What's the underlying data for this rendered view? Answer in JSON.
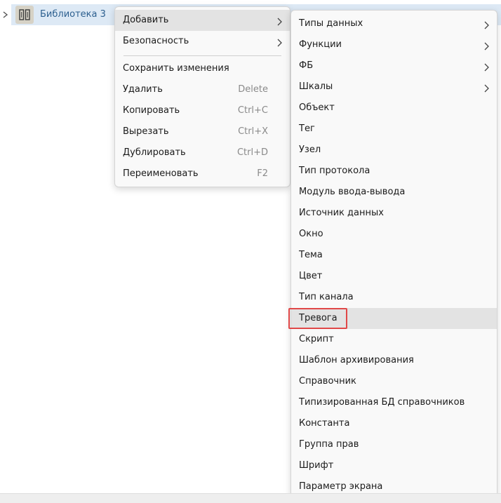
{
  "tree": {
    "library_label": "Библиотека 3"
  },
  "context_menu": {
    "items": [
      {
        "label": "Добавить",
        "has_submenu": true
      },
      {
        "label": "Безопасность",
        "has_submenu": true
      },
      {
        "label": "Сохранить изменения",
        "shortcut": ""
      },
      {
        "label": "Удалить",
        "shortcut": "Delete"
      },
      {
        "label": "Копировать",
        "shortcut": "Ctrl+C"
      },
      {
        "label": "Вырезать",
        "shortcut": "Ctrl+X"
      },
      {
        "label": "Дублировать",
        "shortcut": "Ctrl+D"
      },
      {
        "label": "Переименовать",
        "shortcut": "F2"
      }
    ]
  },
  "add_submenu": {
    "items": [
      {
        "label": "Типы данных",
        "has_submenu": true
      },
      {
        "label": "Функции",
        "has_submenu": true
      },
      {
        "label": "ФБ",
        "has_submenu": true
      },
      {
        "label": "Шкалы",
        "has_submenu": true
      },
      {
        "label": "Объект"
      },
      {
        "label": "Тег"
      },
      {
        "label": "Узел"
      },
      {
        "label": "Тип протокола"
      },
      {
        "label": "Модуль ввода-вывода"
      },
      {
        "label": "Источник данных"
      },
      {
        "label": "Окно"
      },
      {
        "label": "Тема"
      },
      {
        "label": "Цвет"
      },
      {
        "label": "Тип канала"
      },
      {
        "label": "Тревога",
        "highlighted": true
      },
      {
        "label": "Скрипт"
      },
      {
        "label": "Шаблон архивирования"
      },
      {
        "label": "Справочник"
      },
      {
        "label": "Типизированная БД справочников"
      },
      {
        "label": "Константа"
      },
      {
        "label": "Группа прав"
      },
      {
        "label": "Шрифт"
      },
      {
        "label": "Параметр экрана"
      }
    ]
  },
  "colors": {
    "selection_bg": "#dde9f5",
    "label_blue": "#2c5f8f",
    "highlight_border": "#e04848",
    "hover_bg": "#e3e3e3"
  }
}
